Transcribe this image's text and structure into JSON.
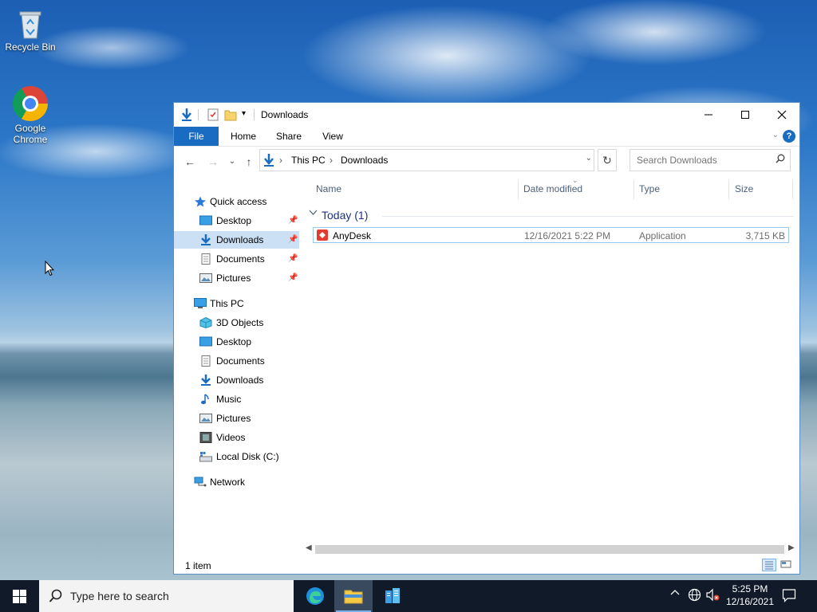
{
  "desktop": {
    "icons": [
      {
        "label": "Recycle Bin",
        "icon": "recycle-bin-icon"
      },
      {
        "label": "Google Chrome",
        "icon": "chrome-icon"
      }
    ]
  },
  "window": {
    "title": "Downloads",
    "ribbon_tabs": {
      "file": "File",
      "home": "Home",
      "share": "Share",
      "view": "View"
    },
    "address": {
      "crumbs": [
        "This PC",
        "Downloads"
      ]
    },
    "search": {
      "placeholder": "Search Downloads"
    },
    "nav": {
      "quick_access": "Quick access",
      "qa_items": [
        "Desktop",
        "Downloads",
        "Documents",
        "Pictures"
      ],
      "this_pc": "This PC",
      "pc_items": [
        "3D Objects",
        "Desktop",
        "Documents",
        "Downloads",
        "Music",
        "Pictures",
        "Videos",
        "Local Disk (C:)"
      ],
      "network": "Network",
      "selected": "Downloads"
    },
    "columns": {
      "name": "Name",
      "date": "Date modified",
      "type": "Type",
      "size": "Size"
    },
    "group": {
      "label": "Today (1)"
    },
    "files": [
      {
        "name": "AnyDesk",
        "date": "12/16/2021 5:22 PM",
        "type": "Application",
        "size": "3,715 KB"
      }
    ],
    "status": "1 item"
  },
  "taskbar": {
    "search_placeholder": "Type here to search",
    "clock_time": "5:25 PM",
    "clock_date": "12/16/2021"
  },
  "colors": {
    "accent": "#1a6cc2",
    "selection": "#cce0f5",
    "taskbar": "#101a28"
  }
}
